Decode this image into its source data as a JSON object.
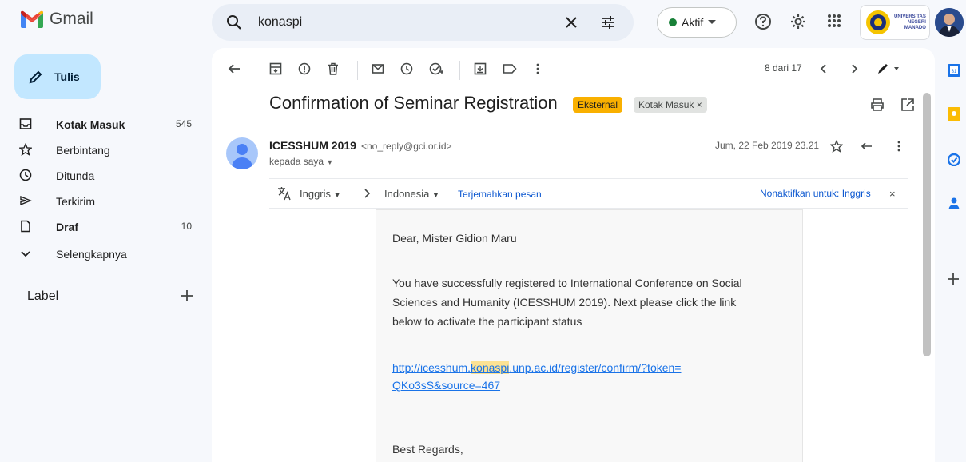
{
  "app": {
    "name": "Gmail"
  },
  "search": {
    "query": "konaspi"
  },
  "status": {
    "label": "Aktif"
  },
  "university": {
    "line1": "UNIVERSITAS",
    "line2": "NEGERI",
    "line3": "MANADO"
  },
  "compose": {
    "label": "Tulis"
  },
  "sidebar": {
    "items": [
      {
        "label": "Kotak Masuk",
        "count": "545"
      },
      {
        "label": "Berbintang",
        "count": ""
      },
      {
        "label": "Ditunda",
        "count": ""
      },
      {
        "label": "Terkirim",
        "count": ""
      },
      {
        "label": "Draf",
        "count": "10"
      },
      {
        "label": "Selengkapnya",
        "count": ""
      }
    ],
    "labels_heading": "Label"
  },
  "toolbar": {
    "pager": "8 dari 17"
  },
  "message": {
    "subject": "Confirmation of Seminar Registration",
    "chip_external": "Eksternal",
    "chip_inbox": "Kotak Masuk",
    "chip_inbox_close": "×",
    "sender_name": "ICESSHUM 2019",
    "sender_email": "<no_reply@gci.or.id>",
    "to": "kepada saya",
    "date": "Jum, 22 Feb 2019 23.21"
  },
  "translate": {
    "from": "Inggris",
    "to": "Indonesia",
    "action": "Terjemahkan pesan",
    "disable": "Nonaktifkan untuk: Inggris",
    "close": "×"
  },
  "body": {
    "greeting": "Dear, Mister Gidion Maru",
    "para1_l1": "You have successfully registered to International Conference on Social",
    "para1_l2": "Sciences and Humanity (ICESSHUM 2019). Next please click the link",
    "para1_l3": "below to activate the participant status",
    "link_pre": "http://icesshum.",
    "link_hl": "konaspi",
    "link_post": ".unp.ac.id/register/confirm/?token=",
    "link_l2": "QKo3sS&source=467",
    "closing": "Best Regards,"
  },
  "colors": {
    "accent": "#c2e7ff",
    "external_chip": "#f9b000",
    "highlight": "#fde293",
    "link": "#1a73e8"
  }
}
